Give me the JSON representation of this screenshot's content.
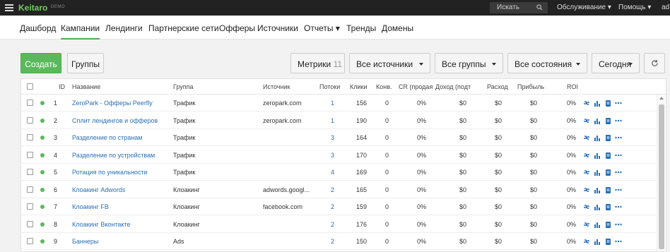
{
  "app": {
    "logo": "Keitaro",
    "badge": "DEMO",
    "search_label": "Искать",
    "menu": [
      "Обслуживание",
      "Помощь",
      "ad"
    ]
  },
  "nav": [
    "Дашборд",
    "Кампании",
    "Лендинги",
    "Партнерские сети",
    "Офферы",
    "Источники",
    "Отчеты",
    "Тренды",
    "Домены"
  ],
  "nav_active": "Кампании",
  "toolbar": {
    "create": "Создать",
    "groups": "Группы",
    "metrics": "Метрики",
    "metrics_count": "11",
    "sources": "Все источники",
    "all_groups": "Все группы",
    "states": "Все состояния",
    "period": "Сегодня"
  },
  "table": {
    "headers": [
      "ID",
      "Название",
      "Группа",
      "Источник",
      "Потоки",
      "Клики",
      "Конв.",
      "CR (продая",
      "Доход (подт",
      "Расход",
      "Прибыль",
      "ROI"
    ],
    "rows": [
      {
        "id": "1",
        "name": "ZeroPark - Офферы Peerfly",
        "group": "Трафик",
        "source": "zeropark.com",
        "streams": "1",
        "clicks": "156",
        "conv": "0",
        "cr": "0%",
        "revenue": "$0",
        "cost": "$0",
        "profit": "$0",
        "roi": "0%"
      },
      {
        "id": "2",
        "name": "Сплит лендингов и офферов",
        "group": "Трафик",
        "source": "zeropark.com",
        "streams": "1",
        "clicks": "190",
        "conv": "0",
        "cr": "0%",
        "revenue": "$0",
        "cost": "$0",
        "profit": "$0",
        "roi": "0%"
      },
      {
        "id": "3",
        "name": "Разделение по странам",
        "group": "Трафик",
        "source": "",
        "streams": "3",
        "clicks": "164",
        "conv": "0",
        "cr": "0%",
        "revenue": "$0",
        "cost": "$0",
        "profit": "$0",
        "roi": "0%"
      },
      {
        "id": "4",
        "name": "Разделение по устройствам",
        "group": "Трафик",
        "source": "",
        "streams": "3",
        "clicks": "170",
        "conv": "0",
        "cr": "0%",
        "revenue": "$0",
        "cost": "$0",
        "profit": "$0",
        "roi": "0%"
      },
      {
        "id": "5",
        "name": "Ротация по уникальности",
        "group": "Трафик",
        "source": "",
        "streams": "4",
        "clicks": "169",
        "conv": "0",
        "cr": "0%",
        "revenue": "$0",
        "cost": "$0",
        "profit": "$0",
        "roi": "0%"
      },
      {
        "id": "6",
        "name": "Клоакинг Adwords",
        "group": "Клоакинг",
        "source": "adwords.googl...",
        "streams": "2",
        "clicks": "165",
        "conv": "0",
        "cr": "0%",
        "revenue": "$0",
        "cost": "$0",
        "profit": "$0",
        "roi": "0%"
      },
      {
        "id": "7",
        "name": "Клоакинг FB",
        "group": "Клоакинг",
        "source": "facebook.com",
        "streams": "2",
        "clicks": "159",
        "conv": "0",
        "cr": "0%",
        "revenue": "$0",
        "cost": "$0",
        "profit": "$0",
        "roi": "0%"
      },
      {
        "id": "8",
        "name": "Клоакинг Вконтакте",
        "group": "Клоакинг",
        "source": "",
        "streams": "2",
        "clicks": "176",
        "conv": "0",
        "cr": "0%",
        "revenue": "$0",
        "cost": "$0",
        "profit": "$0",
        "roi": "0%"
      },
      {
        "id": "9",
        "name": "Баннеры",
        "group": "Ads",
        "source": "",
        "streams": "2",
        "clicks": "150",
        "conv": "0",
        "cr": "0%",
        "revenue": "$0",
        "cost": "$0",
        "profit": "$0",
        "roi": "0%"
      }
    ]
  },
  "icons": {
    "row_actions": [
      "link-icon",
      "chart-icon",
      "document-icon",
      "more-icon"
    ],
    "refresh": "refresh-icon",
    "menu": "hamburger-icon",
    "search": "search-icon"
  },
  "colors": {
    "accent": "#5cb85c",
    "link": "#2a6fb5",
    "topbar": "#222222",
    "status": "#5cb85c"
  }
}
